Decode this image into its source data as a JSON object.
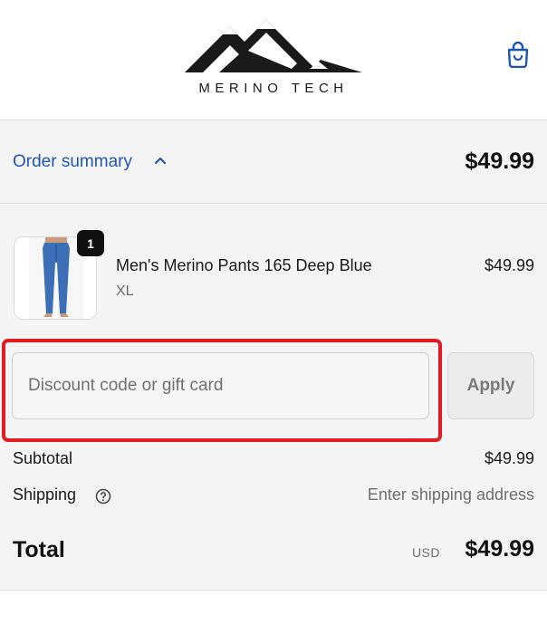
{
  "brand": {
    "name": "MERINO TECH",
    "logo_icon": "mountain-logo-icon"
  },
  "header": {
    "cart_icon": "shopping-bag-icon",
    "accent_color": "#1f56b3"
  },
  "order_summary": {
    "toggle_label": "Order summary",
    "toggle_icon": "chevron-up-icon",
    "total": "$49.99"
  },
  "line_items": [
    {
      "quantity": "1",
      "name": "Men's Merino Pants 165 Deep Blue",
      "variant": "XL",
      "price": "$49.99",
      "image_icon": "product-pants-image"
    }
  ],
  "discount": {
    "placeholder": "Discount code or gift card",
    "value": "",
    "apply_label": "Apply",
    "highlight_color": "#e11b22"
  },
  "costs": {
    "subtotal_label": "Subtotal",
    "subtotal_value": "$49.99",
    "shipping_label": "Shipping",
    "shipping_icon": "help-circle-icon",
    "shipping_value": "Enter shipping address"
  },
  "total": {
    "label": "Total",
    "currency": "USD",
    "value": "$49.99"
  }
}
